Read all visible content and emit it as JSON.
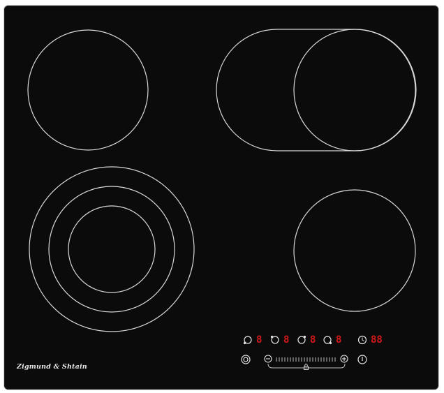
{
  "brand": {
    "name": "Zigmund & Shtain"
  },
  "colors": {
    "glass": "#0b0b0b",
    "ring": "#d8d8d8",
    "led": "#d21818",
    "icon": "#e6e6e6"
  },
  "cooking_zones": [
    {
      "id": "front-left-triple",
      "label": ""
    },
    {
      "id": "rear-left-single",
      "label": ""
    },
    {
      "id": "rear-right-oval",
      "label": ""
    },
    {
      "id": "front-right-single",
      "label": ""
    }
  ],
  "control_panel": {
    "zone_indicators": [
      {
        "icon": "zone-select-icon",
        "display": "8"
      },
      {
        "icon": "zone-select-icon",
        "display": "8"
      },
      {
        "icon": "zone-select-icon",
        "display": "8"
      },
      {
        "icon": "zone-select-icon",
        "display": "8"
      }
    ],
    "timer": {
      "icon": "clock-icon",
      "display": "88"
    },
    "slider": {
      "minus_icon": "minus-icon",
      "plus_icon": "plus-icon",
      "lock_icon": "lock-icon"
    },
    "dual_zone_icon": "dual-ring-icon",
    "power_icon": "power-icon"
  }
}
